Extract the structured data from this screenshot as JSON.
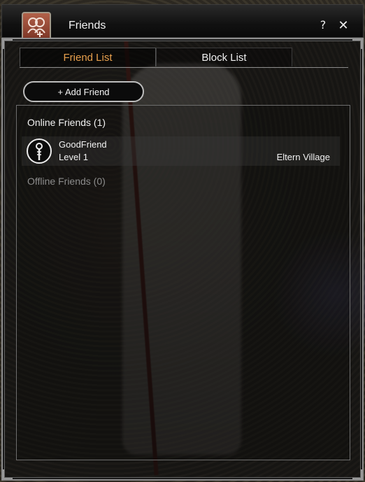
{
  "window": {
    "title": "Friends",
    "help_symbol": "?",
    "close_symbol": "✕",
    "icon": "friends-icon"
  },
  "tabs": [
    {
      "label": "Friend List",
      "active": true
    },
    {
      "label": "Block List",
      "active": false
    }
  ],
  "actions": {
    "add_friend_label": "+ Add Friend"
  },
  "sections": {
    "online_label": "Online Friends (1)",
    "offline_label": "Offline Friends (0)"
  },
  "friends_online": [
    {
      "name": "GoodFriend",
      "level": "Level 1",
      "location": "Eltern Village",
      "icon": "staff-class-icon"
    }
  ],
  "colors": {
    "active_tab": "#e8a04d",
    "text": "#f2f2f2",
    "muted": "#8c8c8c",
    "icon_bg": "#b26149"
  }
}
